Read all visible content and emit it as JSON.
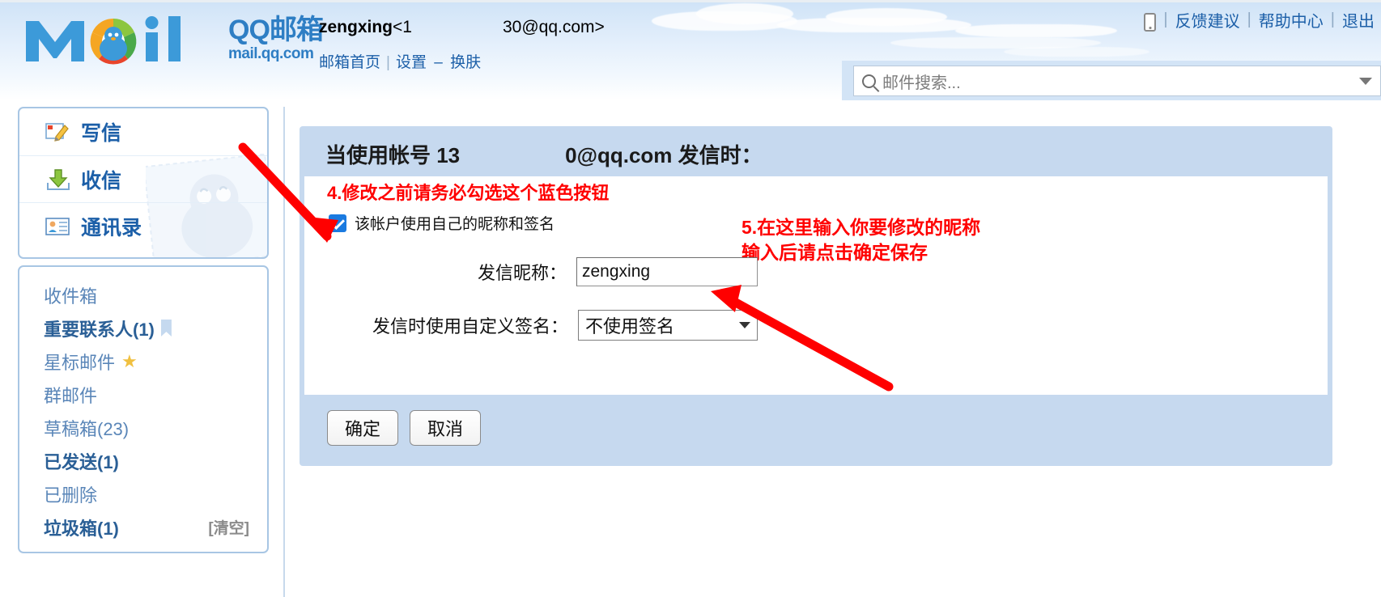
{
  "header": {
    "logo": {
      "brand_cn": "QQ邮箱",
      "brand_url": "mail.qq.com",
      "mark": "mail-logo"
    },
    "account": {
      "name": "zengxing",
      "email_prefix": "<1",
      "email_suffix": "30@qq.com>"
    },
    "account_links": [
      {
        "label": "邮箱首页",
        "name": "mail-home-link"
      },
      {
        "label": "设置",
        "name": "settings-link"
      },
      {
        "label": "换肤",
        "name": "change-skin-link"
      }
    ],
    "top_links": [
      {
        "label": "反馈建议",
        "name": "feedback-link"
      },
      {
        "label": "帮助中心",
        "name": "help-center-link"
      },
      {
        "label": "退出",
        "name": "logout-link"
      }
    ],
    "mobile_icon": "mobile-phone-icon",
    "search": {
      "placeholder": "邮件搜索...",
      "value": "",
      "icon": "search-icon",
      "caret": "chevron-down-icon"
    }
  },
  "sidebar": {
    "nav": [
      {
        "label": "写信",
        "icon": "compose-icon"
      },
      {
        "label": "收信",
        "icon": "inbox-download-icon"
      },
      {
        "label": "通讯录",
        "icon": "contacts-card-icon"
      }
    ],
    "folders": [
      {
        "label": "收件箱",
        "bold": false,
        "badge": "",
        "action": ""
      },
      {
        "label": "重要联系人(1)",
        "bold": true,
        "badge": "flag-icon",
        "action": ""
      },
      {
        "label": "星标邮件",
        "bold": false,
        "badge": "star-icon",
        "action": ""
      },
      {
        "label": "群邮件",
        "bold": false,
        "badge": "",
        "action": ""
      },
      {
        "label": "草稿箱(23)",
        "bold": false,
        "badge": "",
        "action": ""
      },
      {
        "label": "已发送(1)",
        "bold": true,
        "badge": "",
        "action": ""
      },
      {
        "label": "已删除",
        "bold": false,
        "badge": "",
        "action": ""
      },
      {
        "label": "垃圾箱(1)",
        "bold": true,
        "badge": "",
        "action": "[清空]"
      }
    ]
  },
  "main": {
    "card_title_prefix": "当使用帐号 13",
    "card_title_suffix": "0@qq.com 发信时：",
    "annotation_1": "4.修改之前请务必勾选这个蓝色按钮",
    "annotation_2_line1": "5.在这里输入你要修改的昵称",
    "annotation_2_line2": "输入后请点击确定保存",
    "checkbox": {
      "checked": true,
      "label": "该帐户使用自己的昵称和签名"
    },
    "nickname_field": {
      "label": "发信昵称：",
      "value": "zengxing",
      "placeholder": ""
    },
    "signature_field": {
      "label": "发信时使用自定义签名：",
      "value": "不使用签名",
      "caret": "chevron-down-icon"
    },
    "buttons": [
      {
        "label": "确定",
        "name": "confirm-button"
      },
      {
        "label": "取消",
        "name": "cancel-button"
      }
    ]
  },
  "colors": {
    "brand_blue": "#2e7ec4",
    "link_blue": "#1c5fa8",
    "panel_blue": "#c6d9ef",
    "annotation_red": "#ff0000",
    "checkbox_blue": "#1a7ae0"
  }
}
